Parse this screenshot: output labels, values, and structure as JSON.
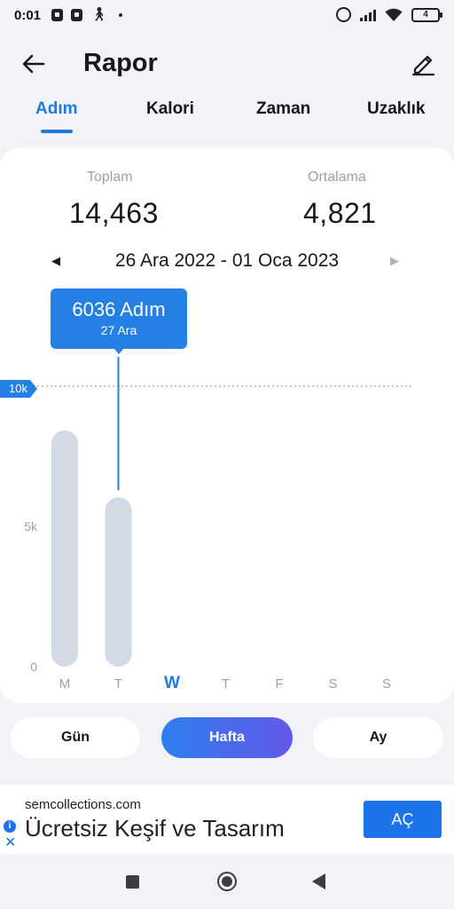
{
  "status_bar": {
    "time": "0:01",
    "battery": "4"
  },
  "header": {
    "title": "Rapor"
  },
  "tabs": [
    {
      "label": "Adım",
      "active": true
    },
    {
      "label": "Kalori",
      "active": false
    },
    {
      "label": "Zaman",
      "active": false
    },
    {
      "label": "Uzaklık",
      "active": false
    }
  ],
  "summary": {
    "total_label": "Toplam",
    "total_value": "14,463",
    "average_label": "Ortalama",
    "average_value": "4,821"
  },
  "date_range": "26 Ara 2022 - 01 Oca 2023",
  "tooltip": {
    "value": "6036 Adım",
    "date": "27 Ara"
  },
  "colors": {
    "accent": "#2580e6",
    "bar": "#d3d9e5",
    "today": "#1f7ae0"
  },
  "chart_data": {
    "type": "bar",
    "categories": [
      "M",
      "T",
      "W",
      "T",
      "F",
      "S",
      "S"
    ],
    "values": [
      8427,
      6036,
      0,
      0,
      0,
      0,
      0
    ],
    "highlight_index": 2,
    "selected_index": 1,
    "ylim": [
      0,
      10000
    ],
    "y_ticks": [
      "0",
      "5k"
    ],
    "reference_line": {
      "value": 10000,
      "label": "10k"
    }
  },
  "period_selector": [
    {
      "label": "Gün",
      "active": false
    },
    {
      "label": "Hafta",
      "active": true
    },
    {
      "label": "Ay",
      "active": false
    }
  ],
  "ad": {
    "domain": "semcollections.com",
    "headline": "Ücretsiz Keşif ve Tasarım",
    "cta": "AÇ"
  }
}
